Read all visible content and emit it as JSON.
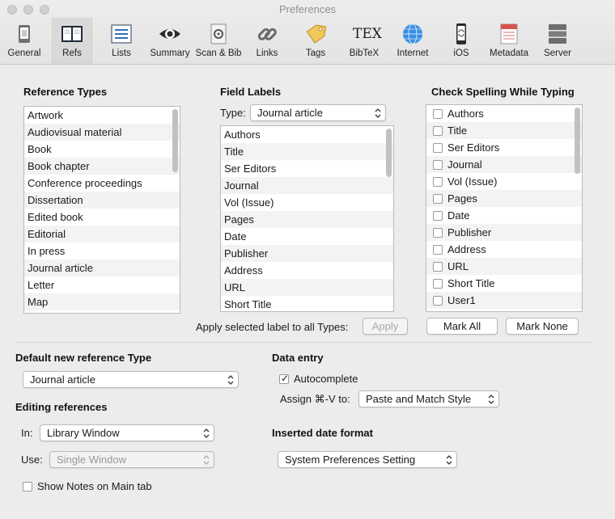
{
  "window": {
    "title": "Preferences"
  },
  "toolbar": [
    {
      "id": "general",
      "label": "General",
      "icon": "general-icon"
    },
    {
      "id": "refs",
      "label": "Refs",
      "icon": "refs-icon",
      "selected": true
    },
    {
      "id": "lists",
      "label": "Lists",
      "icon": "lists-icon"
    },
    {
      "id": "summary",
      "label": "Summary",
      "icon": "eye-icon"
    },
    {
      "id": "scan",
      "label": "Scan & Bib",
      "icon": "scan-icon"
    },
    {
      "id": "links",
      "label": "Links",
      "icon": "link-icon"
    },
    {
      "id": "tags",
      "label": "Tags",
      "icon": "tag-icon"
    },
    {
      "id": "bibtex",
      "label": "BibTeX",
      "icon": "tex-icon",
      "icon_text": "TEX"
    },
    {
      "id": "internet",
      "label": "Internet",
      "icon": "globe-icon"
    },
    {
      "id": "ios",
      "label": "iOS",
      "icon": "phone-icon"
    },
    {
      "id": "metadata",
      "label": "Metadata",
      "icon": "metadata-icon"
    },
    {
      "id": "server",
      "label": "Server",
      "icon": "server-icon"
    }
  ],
  "reference_types": {
    "title": "Reference Types",
    "items": [
      "Artwork",
      "Audiovisual material",
      "Book",
      "Book chapter",
      "Conference proceedings",
      "Dissertation",
      "Edited book",
      "Editorial",
      "In press",
      "Journal article",
      "Letter",
      "Map"
    ]
  },
  "field_labels": {
    "title": "Field Labels",
    "type_label": "Type:",
    "type_value": "Journal article",
    "items": [
      "Authors",
      "Title",
      "Ser Editors",
      "Journal",
      "Vol (Issue)",
      "Pages",
      "Date",
      "Publisher",
      "Address",
      "URL",
      "Short Title"
    ],
    "apply_label": "Apply selected label to all Types:",
    "apply_button": "Apply"
  },
  "spelling": {
    "title": "Check Spelling While Typing",
    "items": [
      "Authors",
      "Title",
      "Ser Editors",
      "Journal",
      "Vol (Issue)",
      "Pages",
      "Date",
      "Publisher",
      "Address",
      "URL",
      "Short Title",
      "User1"
    ],
    "mark_all": "Mark All",
    "mark_none": "Mark None"
  },
  "default_type": {
    "title": "Default new reference Type",
    "value": "Journal article"
  },
  "data_entry": {
    "title": "Data entry",
    "autocomplete_label": "Autocomplete",
    "autocomplete_checked": true,
    "assign_label": "Assign ⌘-V to:",
    "assign_value": "Paste and Match Style"
  },
  "editing": {
    "title": "Editing references",
    "in_label": "In:",
    "in_value": "Library Window",
    "use_label": "Use:",
    "use_value": "Single Window",
    "show_notes_label": "Show Notes on Main tab",
    "show_notes_checked": false
  },
  "date_format": {
    "title": "Inserted date format",
    "value": "System Preferences Setting"
  }
}
